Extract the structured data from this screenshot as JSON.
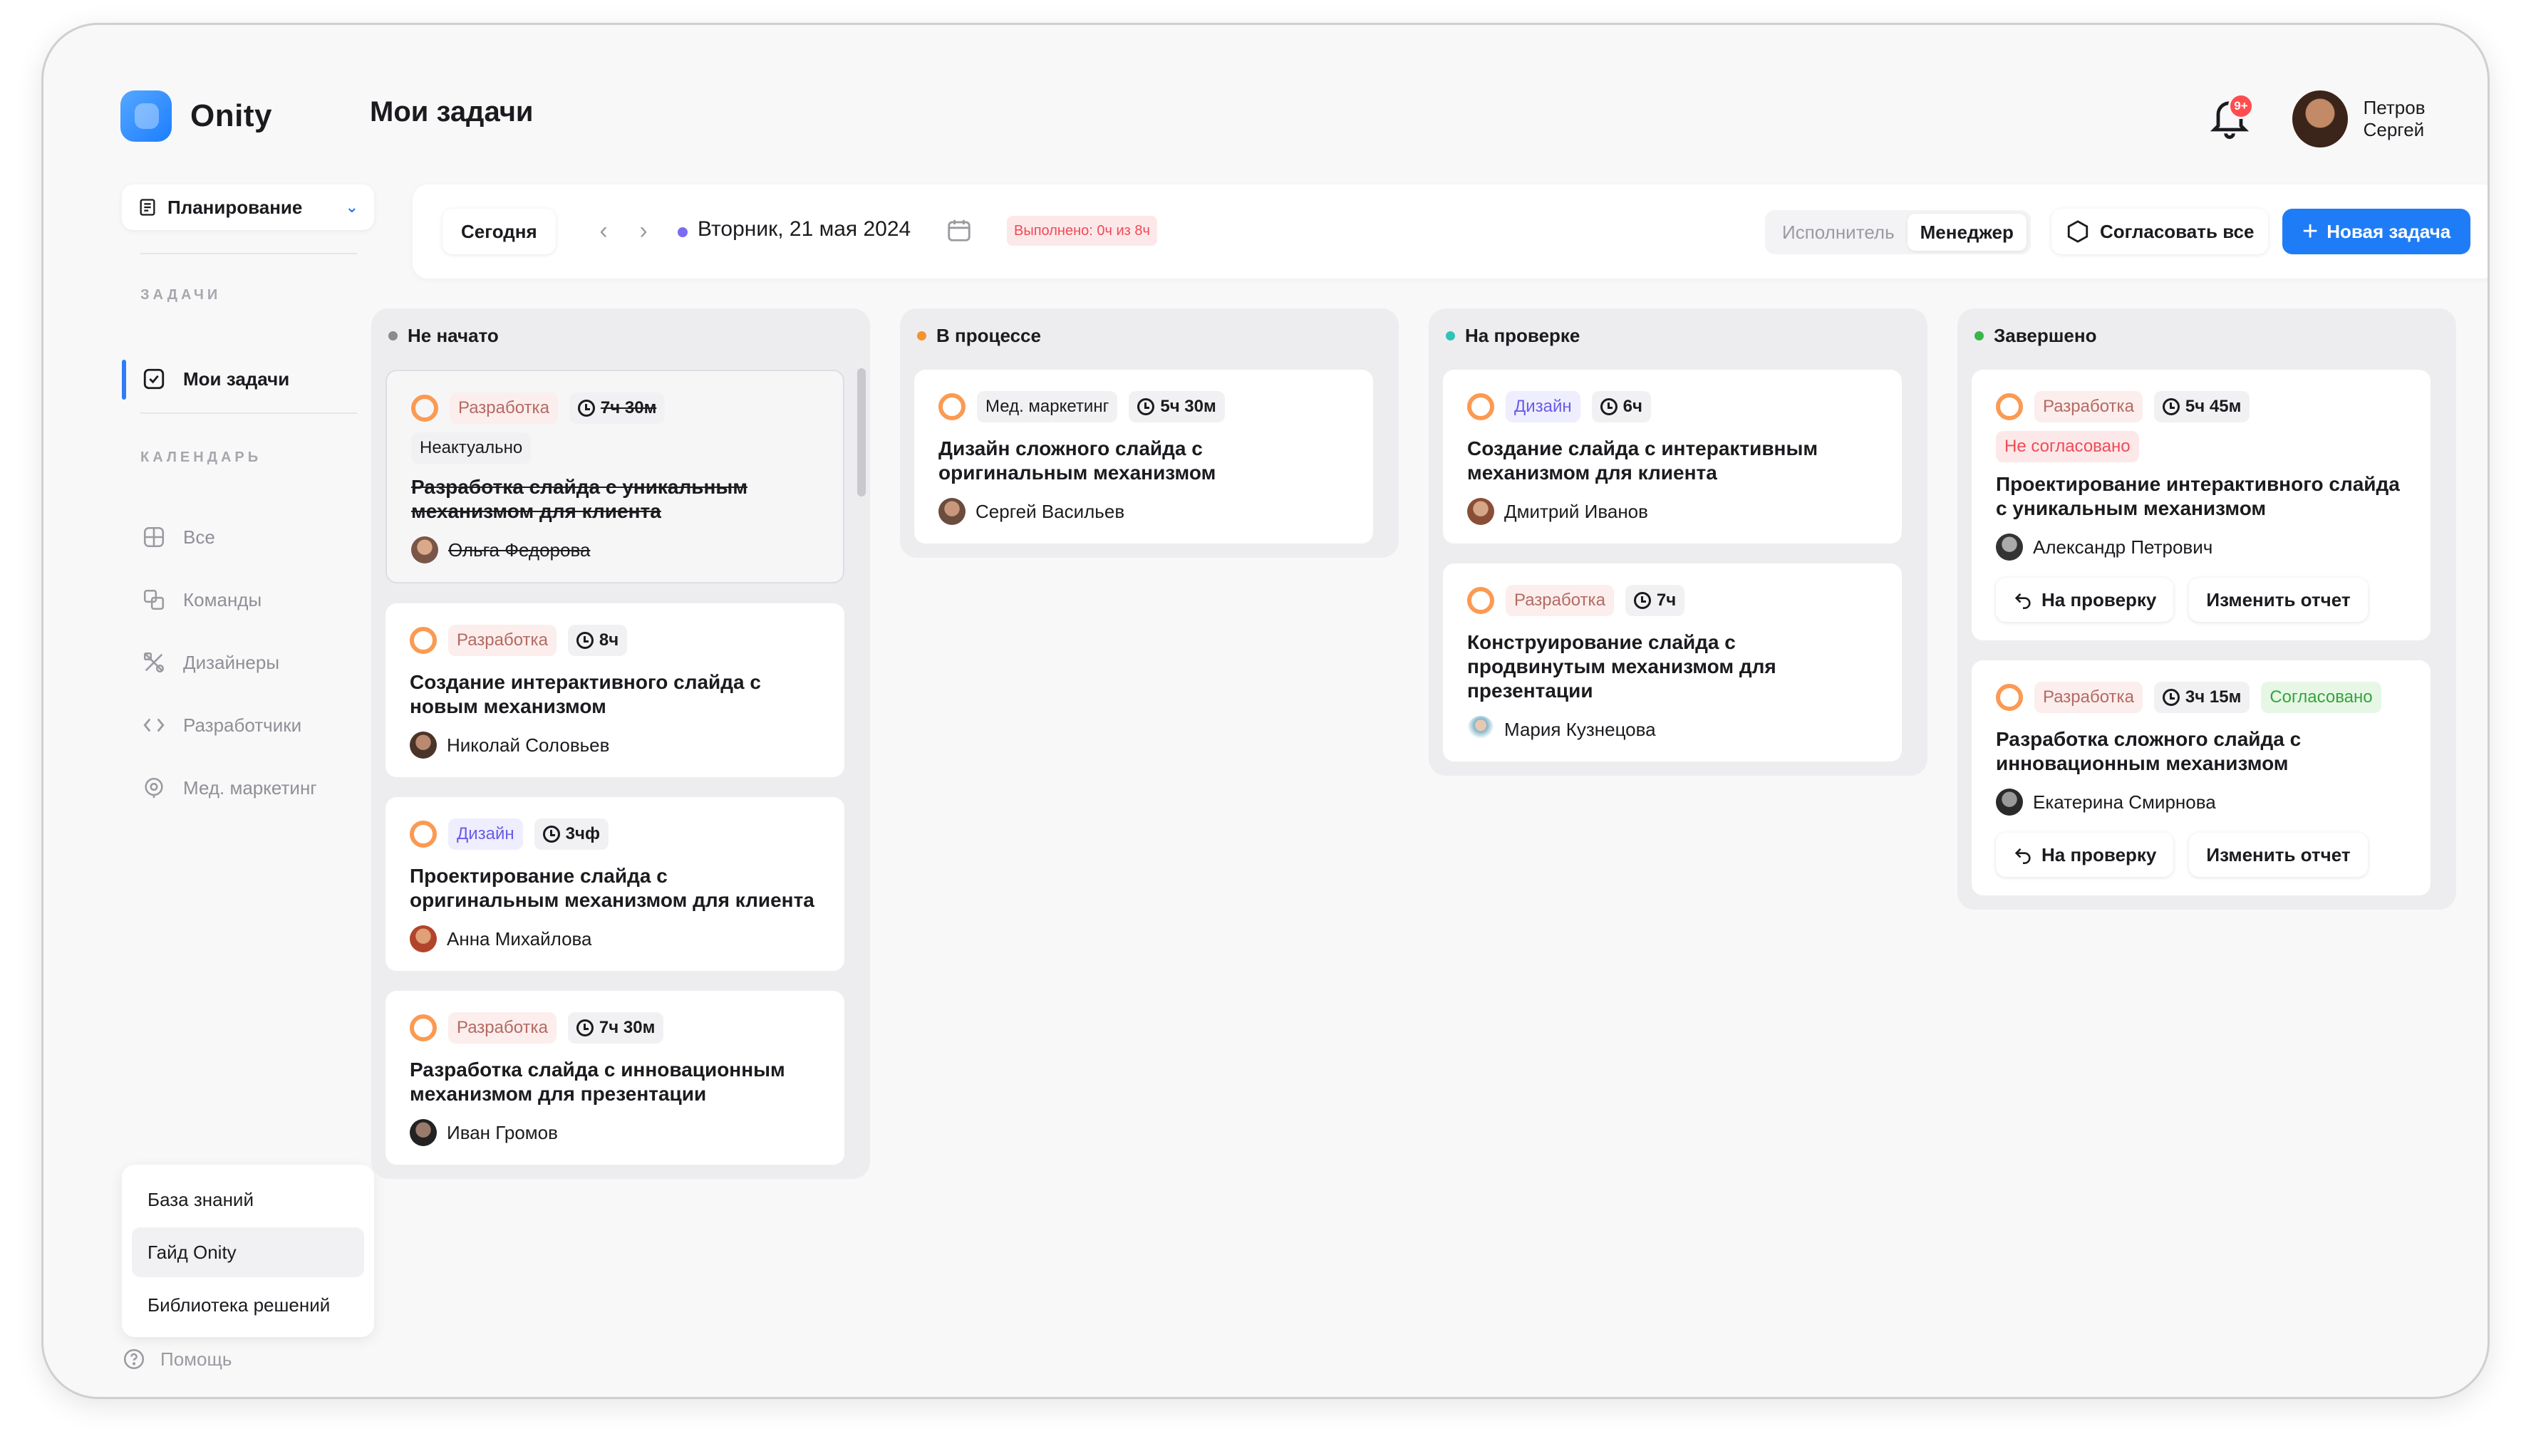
{
  "app": {
    "name": "Onity",
    "page_title": "Мои задачи"
  },
  "sidebar": {
    "workspace": "Планирование",
    "section_tasks": "ЗАДАЧИ",
    "my_tasks": "Мои задачи",
    "section_calendar": "КАЛЕНДАРЬ",
    "calendar_items": [
      {
        "label": "Все",
        "icon": "grid-icon"
      },
      {
        "label": "Команды",
        "icon": "teams-icon"
      },
      {
        "label": "Дизайнеры",
        "icon": "design-tools-icon"
      },
      {
        "label": "Разработчики",
        "icon": "code-icon"
      },
      {
        "label": "Мед. маркетинг",
        "icon": "marketing-icon"
      }
    ],
    "help_menu": [
      "База знаний",
      "Гайд Onity",
      "Библиотека решений"
    ],
    "help": "Помощь"
  },
  "header": {
    "notifications_badge": "9+",
    "user_name": "Петров Сергей"
  },
  "toolbar": {
    "today": "Сегодня",
    "date": "Вторник, 21 мая 2024",
    "done": "Выполнено: 0ч из 8ч",
    "role_executor": "Исполнитель",
    "role_manager": "Менеджер",
    "approve_all": "Согласовать все",
    "new_task": "Новая задача"
  },
  "colors": {
    "accent": "#1f7cf7",
    "status_ring": "#fb9a52"
  },
  "columns": [
    {
      "title": "Не начато",
      "dot": "#8a8a90",
      "cards": [
        {
          "tag": "Разработка",
          "time": "7ч 30м",
          "extra": "Неактуально",
          "title": "Разработка слайда с уникальным механизмом для клиента",
          "person": "Ольга Федорова"
        },
        {
          "tag": "Разработка",
          "time": "8ч",
          "title": "Создание интерактивного слайда с новым механизмом",
          "person": "Николай Соловьев"
        },
        {
          "tag": "Дизайн",
          "time": "3чф",
          "title": "Проектирование слайда с оригинальным механизмом для клиента",
          "person": "Анна Михайлова"
        },
        {
          "tag": "Разработка",
          "time": "7ч 30м",
          "title": "Разработка слайда с инновационным механизмом для презентации",
          "person": "Иван Громов"
        }
      ]
    },
    {
      "title": "В процессе",
      "dot": "#f5922e",
      "cards": [
        {
          "tag": "Мед. маркетинг",
          "time": "5ч 30м",
          "title": "Дизайн сложного слайда с оригинальным механизмом",
          "person": "Сергей Васильев"
        }
      ]
    },
    {
      "title": "На проверке",
      "dot": "#2ec4b6",
      "cards": [
        {
          "tag": "Дизайн",
          "time": "6ч",
          "title": "Создание слайда с интерактивным механизмом для клиента",
          "person": "Дмитрий Иванов"
        },
        {
          "tag": "Разработка",
          "time": "7ч",
          "title": "Конструирование слайда с продвинутым механизмом для презентации",
          "person": "Мария Кузнецова"
        }
      ]
    },
    {
      "title": "Завершено",
      "dot": "#3ab54a",
      "cards": [
        {
          "tag": "Разработка",
          "time": "5ч 45м",
          "status": "Не согласовано",
          "title": "Проектирование интерактивного слайда с уникальным механизмом",
          "person": "Александр Петрович",
          "action_review": "На проверку",
          "action_edit": "Изменить отчет"
        },
        {
          "tag": "Разработка",
          "time": "3ч 15м",
          "status": "Согласовано",
          "title": "Разработка сложного слайда с инновационным механизмом",
          "person": "Екатерина Смирнова",
          "action_review": "На проверку",
          "action_edit": "Изменить отчет"
        }
      ]
    }
  ]
}
